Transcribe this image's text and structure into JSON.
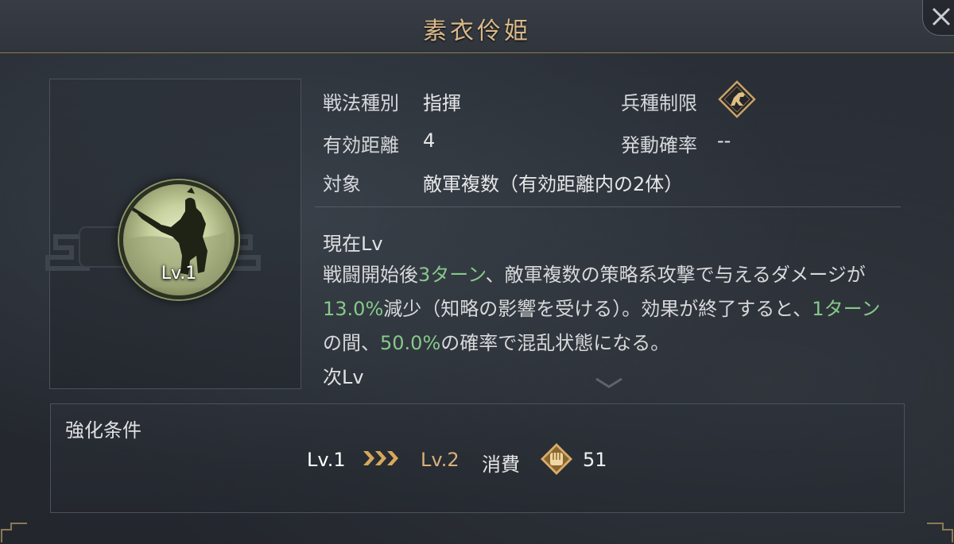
{
  "header": {
    "title": "素衣伶姫"
  },
  "portrait": {
    "level": "Lv.1"
  },
  "info": {
    "tactic_type_label": "戦法種別",
    "tactic_type_value": "指揮",
    "troop_limit_label": "兵種制限",
    "troop_limit_icon": "horse-cavalry-icon",
    "range_label": "有効距離",
    "range_value": "4",
    "activation_label": "発動確率",
    "activation_value": "--",
    "target_label": "対象",
    "target_value": "敵軍複数（有効距離内の2体）"
  },
  "current_level": {
    "heading": "現在Lv",
    "desc_segments": [
      "戦闘開始後",
      "3ターン",
      "、敵軍複数の策略系攻撃で与えるダメージが",
      "13.0%",
      "減少（知略の影響を受ける）。効果が終了すると、",
      "1ターン",
      "の間、",
      "50.0%",
      "の確率で混乱状態になる。"
    ]
  },
  "next_level": {
    "heading": "次Lv"
  },
  "enhance": {
    "title": "強化条件",
    "from_level": "Lv.1",
    "to_level": "Lv.2",
    "cost_label": "消費",
    "cost_icon": "fist-token-icon",
    "cost_value": "51"
  },
  "colors": {
    "gold": "#d9b98a",
    "highlight_green": "#86c88a"
  }
}
